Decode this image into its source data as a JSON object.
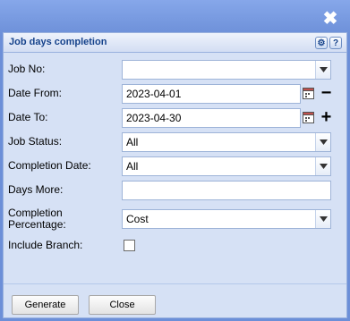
{
  "window": {
    "close_icon_glyph": "✖"
  },
  "panel": {
    "title": "Job days completion",
    "gear_glyph": "⚙",
    "help_glyph": "?"
  },
  "form": {
    "job_no": {
      "label": "Job No:",
      "value": ""
    },
    "date_from": {
      "label": "Date From:",
      "value": "2023-04-01",
      "adjust_glyph": "−"
    },
    "date_to": {
      "label": "Date To:",
      "value": "2023-04-30",
      "adjust_glyph": "+"
    },
    "job_status": {
      "label": "Job Status:",
      "value": "All"
    },
    "completion_date": {
      "label": "Completion Date:",
      "value": "All"
    },
    "days_more": {
      "label": "Days More:",
      "value": ""
    },
    "completion_percentage": {
      "label_line1": "Completion",
      "label_line2": "Percentage:",
      "value": "Cost"
    },
    "include_branch": {
      "label": "Include Branch:",
      "checked": false
    }
  },
  "buttons": {
    "generate": "Generate",
    "close": "Close"
  },
  "colors": {
    "title_text": "#15428b",
    "panel_bg": "#d6e1f5",
    "window_bg": "#6c8fd8"
  }
}
